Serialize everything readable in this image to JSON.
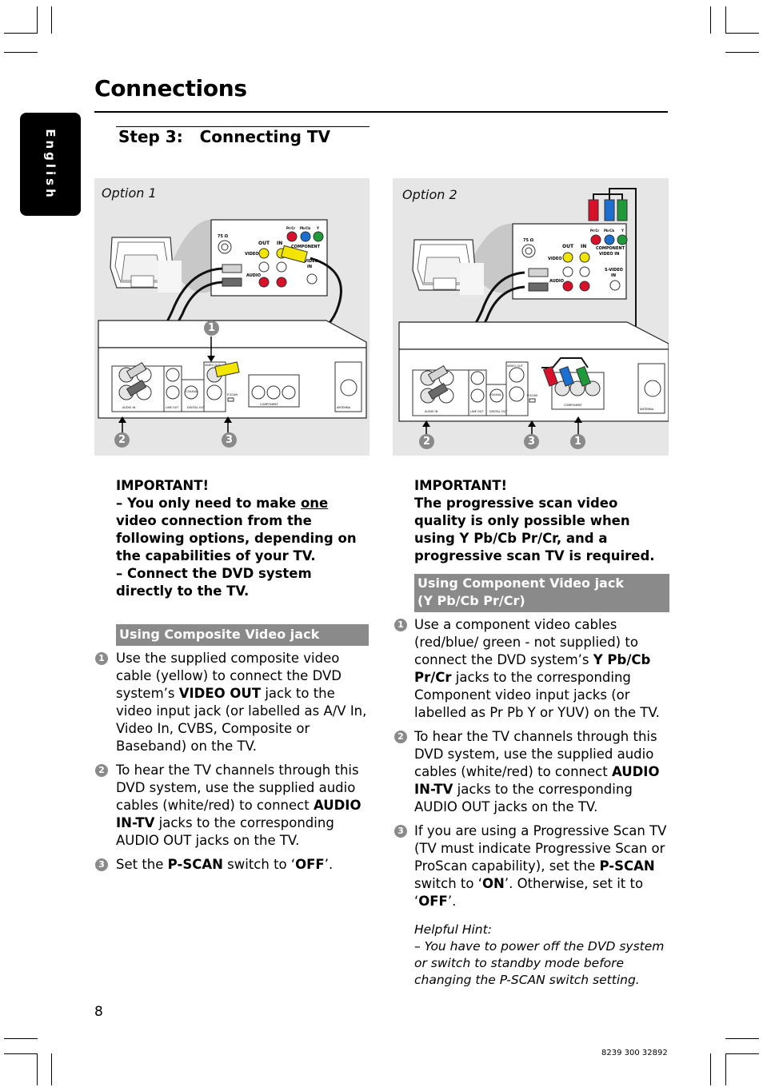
{
  "page": {
    "title": "Connections",
    "language_tab": "English",
    "step_title": "Step 3:   Connecting TV",
    "page_number": "8",
    "document_code": "8239 300 32892"
  },
  "option1": {
    "label": "Option 1",
    "callouts": [
      "1",
      "2",
      "3"
    ],
    "important_heading": "IMPORTANT!",
    "important_lines": [
      {
        "pre": "–  You only need to make ",
        "underlined": "one",
        "post": " video connection from the following options, depending on the capabilities of your TV."
      },
      {
        "pre": "–  Connect the DVD system directly to the TV.",
        "underlined": "",
        "post": ""
      }
    ],
    "section_heading": "Using Composite Video jack",
    "steps": [
      {
        "num": "1",
        "parts": [
          {
            "t": "Use the supplied composite video cable (yellow) to connect the DVD system’s ",
            "b": false
          },
          {
            "t": "VIDEO OUT",
            "b": true
          },
          {
            "t": " jack to the video input jack (or labelled as A/V In, Video In, CVBS, Composite or Baseband) on the TV.",
            "b": false
          }
        ]
      },
      {
        "num": "2",
        "parts": [
          {
            "t": "To hear the TV channels through this DVD system, use the supplied audio cables (white/red) to connect ",
            "b": false
          },
          {
            "t": "AUDIO IN-TV",
            "b": true
          },
          {
            "t": " jacks to the corresponding AUDIO OUT jacks on the TV.",
            "b": false
          }
        ]
      },
      {
        "num": "3",
        "parts": [
          {
            "t": "Set the ",
            "b": false
          },
          {
            "t": "P-SCAN",
            "b": true
          },
          {
            "t": " switch to ‘",
            "b": false
          },
          {
            "t": "OFF",
            "b": true
          },
          {
            "t": "’.",
            "b": false
          }
        ]
      }
    ]
  },
  "option2": {
    "label": "Option 2",
    "callouts": [
      "2",
      "3",
      "1"
    ],
    "important_heading": "IMPORTANT!",
    "important_text": "The progressive scan video quality is only possible when using Y Pb/Cb Pr/Cr, and a progressive scan TV is required.",
    "section_heading_line1": "Using Component Video jack",
    "section_heading_line2": "(Y Pb/Cb Pr/Cr)",
    "steps": [
      {
        "num": "1",
        "parts": [
          {
            "t": "Use a component video cables (red/blue/ green - not supplied) to connect the DVD system’s ",
            "b": false
          },
          {
            "t": "Y Pb/Cb Pr/Cr",
            "b": true
          },
          {
            "t": " jacks to the corresponding Component video input jacks (or labelled as Pr  Pb Y or YUV) on the TV.",
            "b": false
          }
        ]
      },
      {
        "num": "2",
        "parts": [
          {
            "t": "To hear the TV channels through this DVD system, use the supplied audio cables (white/red) to connect ",
            "b": false
          },
          {
            "t": "AUDIO IN-TV",
            "b": true
          },
          {
            "t": " jacks to the corresponding AUDIO OUT jacks on the TV.",
            "b": false
          }
        ]
      },
      {
        "num": "3",
        "parts": [
          {
            "t": "If you are using a Progressive Scan TV (TV must indicate Progressive Scan or ProScan capability), set the ",
            "b": false
          },
          {
            "t": "P-SCAN",
            "b": true
          },
          {
            "t": " switch to ‘",
            "b": false
          },
          {
            "t": "ON",
            "b": true
          },
          {
            "t": "’.  Otherwise, set it to ‘",
            "b": false
          },
          {
            "t": "OFF",
            "b": true
          },
          {
            "t": "’.",
            "b": false
          }
        ]
      }
    ],
    "hint_heading": "Helpful Hint:",
    "hint_text": "–  You have to power off the DVD system or switch to standby mode before changing the P-SCAN switch setting."
  },
  "diagram_labels": {
    "tv_panel": {
      "antenna": "75 Ω",
      "out": "OUT",
      "in": "IN",
      "video": "VIDEO",
      "audio": "AUDIO",
      "l": "L",
      "r": "R",
      "pr": "Pr/Cr",
      "pb": "Pb/Cb",
      "y": "Y",
      "component_in_1": "COMPONENT",
      "component_in_2": "VIDEO IN",
      "svideo_1": "S-VIDEO",
      "svideo_2": "IN"
    },
    "dvd_panel": {
      "video_out": "VIDEO OUT",
      "svideo_out_1": "S-VIDEO",
      "svideo_out_2": "OUT",
      "pscan": "P-SCAN",
      "off_on": "OFF  ON",
      "coaxial": "COAXIAL",
      "digital_out": "DIGITAL OUT",
      "line_out": "LINE OUT",
      "audio_in": "AUDIO IN",
      "tv": "TV",
      "aux": "AUX",
      "component_out_1": "COMPONENT",
      "component_out_2": "VIDEO OUT",
      "mw": "MW",
      "fm": "FM",
      "fm_ohm": "(75Ω)",
      "antenna_1": "MW/FM",
      "antenna_2": "ANTENNA",
      "woofer": "WOOFER"
    }
  },
  "colors": {
    "panel_bg": "#e6e6e6",
    "section_bar": "#8a8a8a",
    "jack_yellow": "#f2e600",
    "jack_red": "#d8102a",
    "jack_blue": "#1a6fd0",
    "jack_green": "#1f9a3a",
    "plug_white": "#d4d4d4",
    "plug_dark": "#6a6a6a"
  }
}
